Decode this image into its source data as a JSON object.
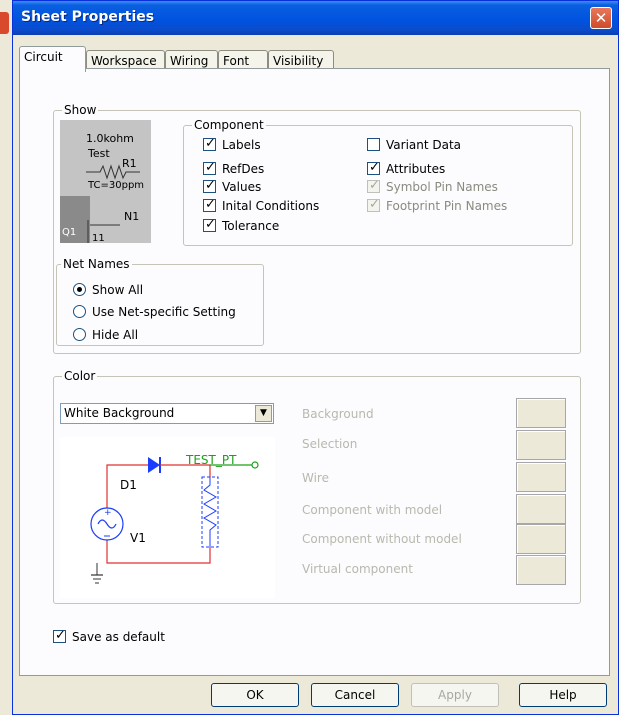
{
  "dialog": {
    "title": "Sheet Properties"
  },
  "tabs": [
    {
      "label": "Circuit",
      "active": true
    },
    {
      "label": "Workspace"
    },
    {
      "label": "Wiring"
    },
    {
      "label": "Font"
    },
    {
      "label": "Visibility"
    }
  ],
  "show": {
    "legend": "Show",
    "preview": {
      "resistance": "1.0kohm",
      "test": "Test",
      "ref": "R1",
      "tc": "TC=30ppm",
      "n1": "N1",
      "q1": "Q1",
      "pin": "11"
    },
    "component": {
      "legend": "Component",
      "items": [
        {
          "label": "Labels",
          "checked": true,
          "enabled": true
        },
        {
          "label": "RefDes",
          "checked": true,
          "enabled": true
        },
        {
          "label": "Values",
          "checked": true,
          "enabled": true
        },
        {
          "label": "Inital Conditions",
          "checked": true,
          "enabled": true
        },
        {
          "label": "Tolerance",
          "checked": true,
          "enabled": true
        },
        {
          "label": "Variant Data",
          "checked": false,
          "enabled": true
        },
        {
          "label": "Attributes",
          "checked": true,
          "enabled": true
        },
        {
          "label": "Symbol Pin Names",
          "checked": true,
          "enabled": false
        },
        {
          "label": "Footprint Pin Names",
          "checked": true,
          "enabled": false
        }
      ]
    },
    "net_names": {
      "legend": "Net Names",
      "options": [
        {
          "label": "Show All",
          "selected": true
        },
        {
          "label": "Use Net-specific Setting",
          "selected": false
        },
        {
          "label": "Hide All",
          "selected": false
        }
      ]
    }
  },
  "color": {
    "legend": "Color",
    "scheme": "White Background",
    "preview": {
      "probe": "TEST_PT",
      "diode": "D1",
      "source": "V1"
    },
    "items": [
      "Background",
      "Selection",
      "Wire",
      "Component with model",
      "Component without model",
      "Virtual component"
    ]
  },
  "save_default": {
    "label": "Save as default",
    "checked": true
  },
  "buttons": {
    "ok": "OK",
    "cancel": "Cancel",
    "apply": "Apply",
    "help": "Help"
  }
}
